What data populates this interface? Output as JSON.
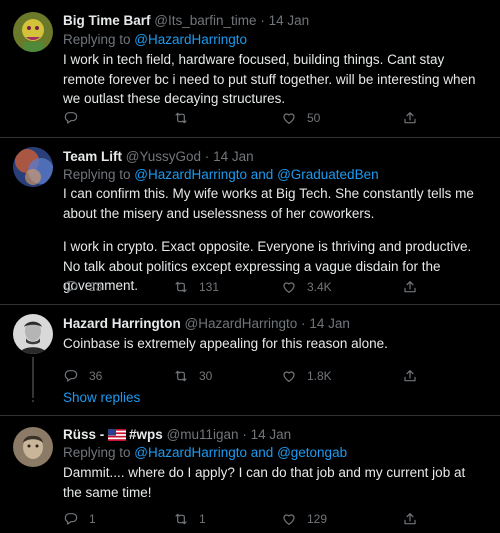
{
  "tweets": [
    {
      "name": "Big Time Barf",
      "handle": "@Its_barfin_time",
      "separator": "·",
      "time": "14 Jan",
      "reply_prefix": "Replying to ",
      "reply_mentions": "@HazardHarringto",
      "text": "I work in tech field, hardware focused, building things. Cant stay remote forever bc i need to put stuff together. will be interesting when we outlast these decaying structures.",
      "replies": "",
      "retweets": "",
      "likes": "50",
      "avatar_colors": [
        "#6b7a2a",
        "#a0306a"
      ]
    },
    {
      "name": "Team Lift",
      "handle": "@YussyGod",
      "separator": "·",
      "time": "14 Jan",
      "reply_prefix": "Replying to ",
      "reply_mentions": "@HazardHarringto and @GraduatedBen",
      "text_paragraphs": [
        "I can confirm this. My wife works at Big Tech. She constantly tells me about the misery and uselessness of her coworkers.",
        "I work in crypto. Exact opposite. Everyone is thriving and productive. No talk about politics except expressing a vague disdain for the government."
      ],
      "replies": "23",
      "retweets": "131",
      "likes": "3.4K",
      "avatar_colors": [
        "#3d5ba8",
        "#c05a3a"
      ]
    },
    {
      "name": "Hazard Harrington",
      "handle": "@HazardHarringto",
      "separator": "·",
      "time": "14 Jan",
      "text": "Coinbase is extremely appealing for this reason alone.",
      "replies": "36",
      "retweets": "30",
      "likes": "1.8K",
      "avatar_colors": [
        "#d9d9d9",
        "#2a2a2a"
      ]
    },
    {
      "name_prefix": "Rüss -",
      "name_suffix": "#wps",
      "handle": "@mu11igan",
      "separator": "·",
      "time": "14 Jan",
      "reply_prefix": "Replying to ",
      "reply_mentions": "@HazardHarringto and @getongab",
      "text": "Dammit.... where do I apply? I can do that job and my current job at the same time!",
      "replies": "1",
      "retweets": "1",
      "likes": "129",
      "avatar_colors": [
        "#8a7a66",
        "#3a3028"
      ]
    }
  ],
  "show_replies": "Show replies",
  "colors": {
    "background": "#000000",
    "text": "#e7e9ea",
    "muted": "#71767b",
    "accent": "#1d9bf0",
    "divider": "#2f3336"
  },
  "icons": {
    "reply": "reply-icon",
    "retweet": "retweet-icon",
    "like": "like-icon",
    "share": "share-icon"
  }
}
